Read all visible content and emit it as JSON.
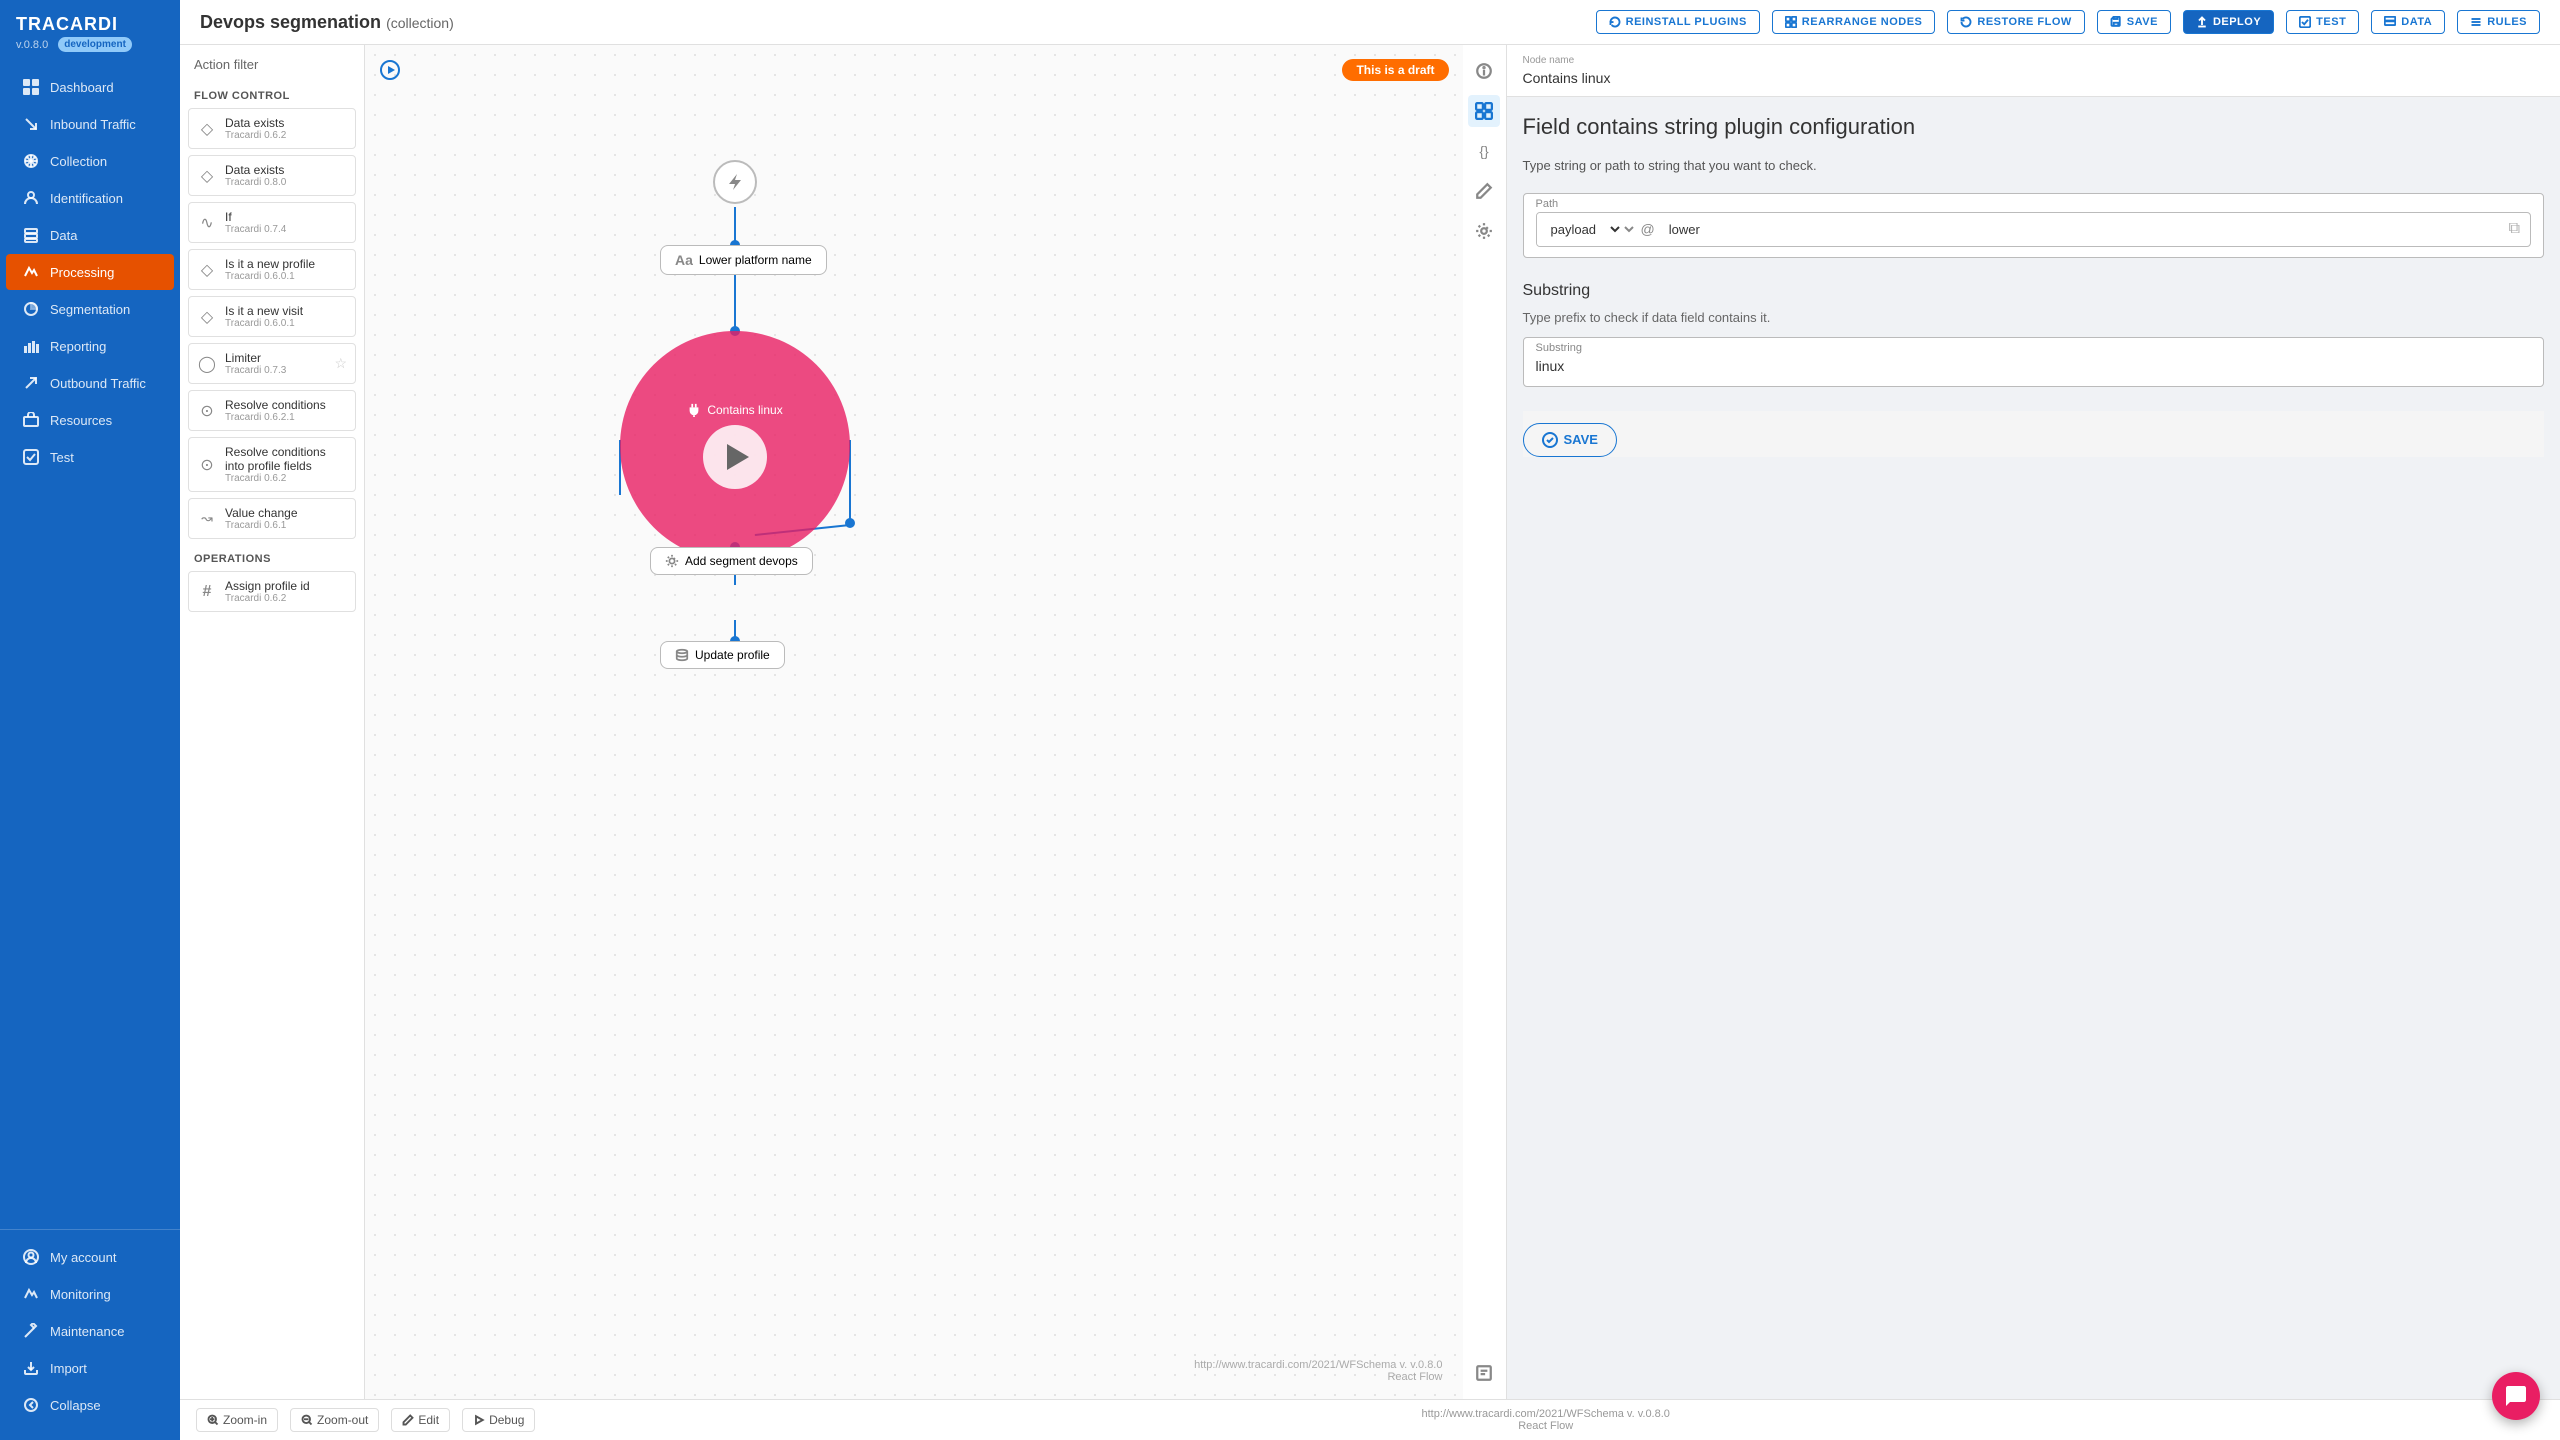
{
  "sidebar": {
    "brand": "TRACARDI",
    "version": "v.0.8.0",
    "env": "development",
    "items": [
      {
        "id": "dashboard",
        "label": "Dashboard",
        "icon": "grid"
      },
      {
        "id": "inbound-traffic",
        "label": "Inbound Traffic",
        "icon": "arrow-down"
      },
      {
        "id": "collection",
        "label": "Collection",
        "icon": "asterisk"
      },
      {
        "id": "identification",
        "label": "Identification",
        "icon": "user"
      },
      {
        "id": "data",
        "label": "Data",
        "icon": "folder"
      },
      {
        "id": "processing",
        "label": "Processing",
        "icon": "activity",
        "active": true
      },
      {
        "id": "segmentation",
        "label": "Segmentation",
        "icon": "pie"
      },
      {
        "id": "reporting",
        "label": "Reporting",
        "icon": "bar-chart"
      },
      {
        "id": "outbound-traffic",
        "label": "Outbound Traffic",
        "icon": "arrow-up"
      },
      {
        "id": "resources",
        "label": "Resources",
        "icon": "layers"
      },
      {
        "id": "test",
        "label": "Test",
        "icon": "check-square"
      }
    ],
    "footer_items": [
      {
        "id": "my-account",
        "label": "My account",
        "icon": "user-circle"
      },
      {
        "id": "monitoring",
        "label": "Monitoring",
        "icon": "activity"
      },
      {
        "id": "maintenance",
        "label": "Maintenance",
        "icon": "tool"
      },
      {
        "id": "import",
        "label": "Import",
        "icon": "download"
      },
      {
        "id": "collapse",
        "label": "Collapse",
        "icon": "chevron-left"
      }
    ]
  },
  "topbar": {
    "title": "Devops segmenation",
    "collection_tag": "(collection)",
    "buttons": [
      {
        "id": "reinstall",
        "label": "REINSTALL PLUGINS",
        "icon": "refresh"
      },
      {
        "id": "rearrange",
        "label": "REARRANGE NODES",
        "icon": "grid"
      },
      {
        "id": "restore",
        "label": "RESTORE FLOW",
        "icon": "rotate-ccw"
      },
      {
        "id": "save",
        "label": "SAVE",
        "icon": "save"
      },
      {
        "id": "deploy",
        "label": "DEPLOY",
        "icon": "upload"
      },
      {
        "id": "test",
        "label": "TEST",
        "icon": "play"
      },
      {
        "id": "data",
        "label": "DATA",
        "icon": "folder"
      },
      {
        "id": "rules",
        "label": "RULES",
        "icon": "list"
      }
    ]
  },
  "flow_panel": {
    "action_filter_placeholder": "Action filter",
    "sections": [
      {
        "title": "FLOW CONTROL",
        "items": [
          {
            "name": "Data exists",
            "version": "Tracardi 0.6.2",
            "icon": "diamond"
          },
          {
            "name": "Data exists",
            "version": "Tracardi 0.8.0",
            "icon": "diamond"
          },
          {
            "name": "If",
            "version": "Tracardi 0.7.4",
            "icon": "wave"
          },
          {
            "name": "Is it a new profile",
            "version": "Tracardi 0.6.0.1",
            "icon": "diamond"
          },
          {
            "name": "Is it a new visit",
            "version": "Tracardi 0.6.0.1",
            "icon": "diamond"
          },
          {
            "name": "Limiter",
            "version": "Tracardi 0.7.3",
            "icon": "circle",
            "star": true
          },
          {
            "name": "Resolve conditions",
            "version": "Tracardi 0.6.2.1",
            "icon": "question"
          },
          {
            "name": "Resolve conditions into profile fields",
            "version": "Tracardi 0.6.2",
            "icon": "question"
          },
          {
            "name": "Value change",
            "version": "Tracardi 0.6.1",
            "icon": "arrow-right-split"
          }
        ]
      },
      {
        "title": "OPERATIONS",
        "items": [
          {
            "name": "Assign profile id",
            "version": "Tracardi 0.6.2",
            "icon": "hash"
          }
        ]
      }
    ]
  },
  "canvas": {
    "draft_badge": "This is a draft",
    "nodes": [
      {
        "id": "lightning",
        "label": ""
      },
      {
        "id": "lower-platform",
        "label": "Lower platform name",
        "icon": "Aa"
      },
      {
        "id": "contains-linux",
        "label": "Contains linux",
        "icon": "plug"
      },
      {
        "id": "add-segment",
        "label": "Add segment devops",
        "icon": "gear"
      },
      {
        "id": "update-profile",
        "label": "Update profile",
        "icon": "db"
      }
    ],
    "footer_url": "http://www.tracardi.com/2021/WFSchema v. v.0.8.0",
    "footer_react": "React Flow"
  },
  "config_panel": {
    "icons": [
      {
        "id": "info",
        "icon": "ℹ",
        "active": false
      },
      {
        "id": "sliders",
        "icon": "⊞",
        "active": true
      },
      {
        "id": "braces",
        "icon": "{}",
        "active": false
      },
      {
        "id": "pen",
        "icon": "✏",
        "active": false
      },
      {
        "id": "gear",
        "icon": "⚙",
        "active": false
      },
      {
        "id": "book",
        "icon": "📖",
        "active": false,
        "bottom": true
      }
    ],
    "node_name_label": "Node name",
    "node_name": "Contains linux",
    "title": "Field contains string plugin configuration",
    "description": "Type string or path to string that you want to check.",
    "path_section": {
      "label": "Path",
      "select_value": "payload",
      "at_symbol": "@",
      "text_value": "lower",
      "copy_icon": "⧉"
    },
    "substring_section": {
      "title": "Substring",
      "description": "Type prefix to check if data field contains it.",
      "input_label": "Substring",
      "input_value": "linux"
    },
    "save_button": "SAVE"
  },
  "bottom_bar": {
    "zoom_in": "Zoom-in",
    "zoom_out": "Zoom-out",
    "edit": "Edit",
    "debug": "Debug",
    "url": "http://www.tracardi.com/2021/WFSchema v. v.0.8.0",
    "react_flow": "React Flow"
  }
}
